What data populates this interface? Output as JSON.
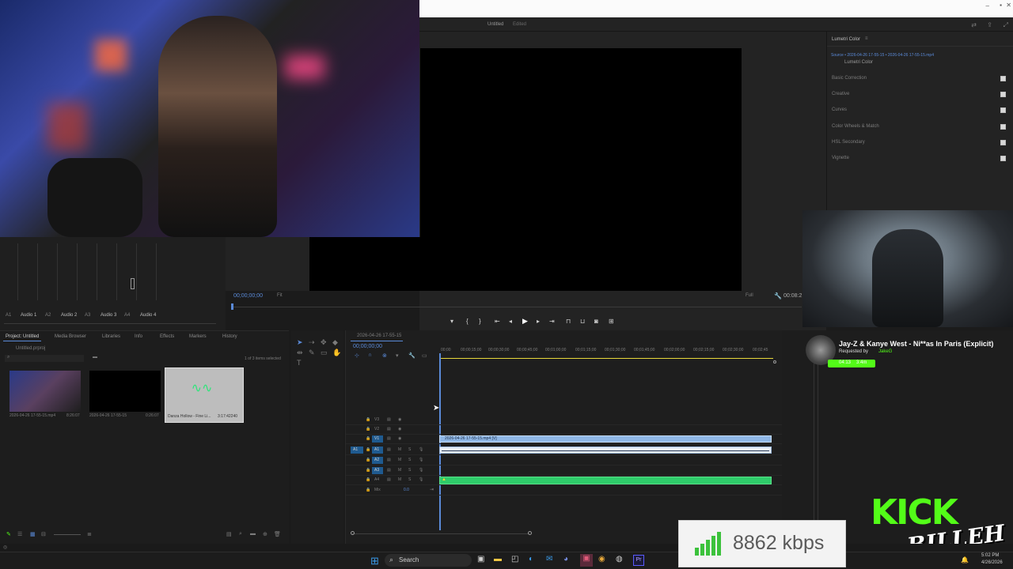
{
  "window": {
    "title": "Untitled",
    "subtitle": "Edited"
  },
  "lumetri": {
    "tab": "Lumetri Color",
    "source": "Source • 2026-04-26 17-55-15 • 2026-04-26 17-55-15.mp4",
    "effect": "Lumetri Color",
    "sections": [
      "Basic Correction",
      "Creative",
      "Curves",
      "Color Wheels & Match",
      "HSL Secondary",
      "Vignette"
    ]
  },
  "program": {
    "timecode": "00;00;00;00",
    "fit": "Fit",
    "full": "Full",
    "end_timecode": "00:08:2"
  },
  "audio": {
    "tracks": [
      "Audio 1",
      "Audio 2",
      "Audio 3",
      "Audio 4"
    ],
    "channels": [
      "A1",
      "A2",
      "A3",
      "A4"
    ]
  },
  "project": {
    "tabs": [
      "Project: Untitled",
      "Media Browser",
      "Libraries",
      "Info",
      "Effects",
      "Markers",
      "History"
    ],
    "file": "Untitled.prproj",
    "selection": "1 of 3 items selected",
    "items": [
      {
        "name": "2026-04-26 17-55-15.mp4",
        "duration": "8:26:07"
      },
      {
        "name": "2026-04-26 17-55-15",
        "duration": "0:26:07"
      },
      {
        "name": "Danza Hollow - Fine Li...",
        "duration": "3:17:42240"
      }
    ]
  },
  "timeline": {
    "sequence": "2026-04-26 17-55-15",
    "timecode": "00;00;00;00",
    "ruler": [
      "00;00",
      "00;00;15;00",
      "00;00;30;00",
      "00;00;45;00",
      "00;01;00;00",
      "00;01;15;00",
      "00;01;30;00",
      "00;01;45;00",
      "00;02;00;00",
      "00;02;15;00",
      "00;02;30;00",
      "00;02;45"
    ],
    "video_tracks": [
      "V3",
      "V2",
      "V1"
    ],
    "audio_tracks": [
      "A1",
      "A2",
      "A3",
      "A4"
    ],
    "mix": "Mix",
    "mix_value": "0.0",
    "clip_label": "2026-04-26 17-55-15.mp4 [V]"
  },
  "song": {
    "title": "Jay-Z & Kanye West - Ni**as In Paris (Explicit)",
    "requested_by_label": "Requested by",
    "requested_by": "JakeG",
    "progress": "04:13",
    "duration": "3:4m"
  },
  "stream": {
    "kbps": "8862 kbps",
    "brand": "KICK",
    "streamer": "BILLEH",
    "accent": "#53fc18"
  },
  "taskbar": {
    "search": "Search",
    "time": "5:02 PM",
    "date": "4/26/2026"
  }
}
